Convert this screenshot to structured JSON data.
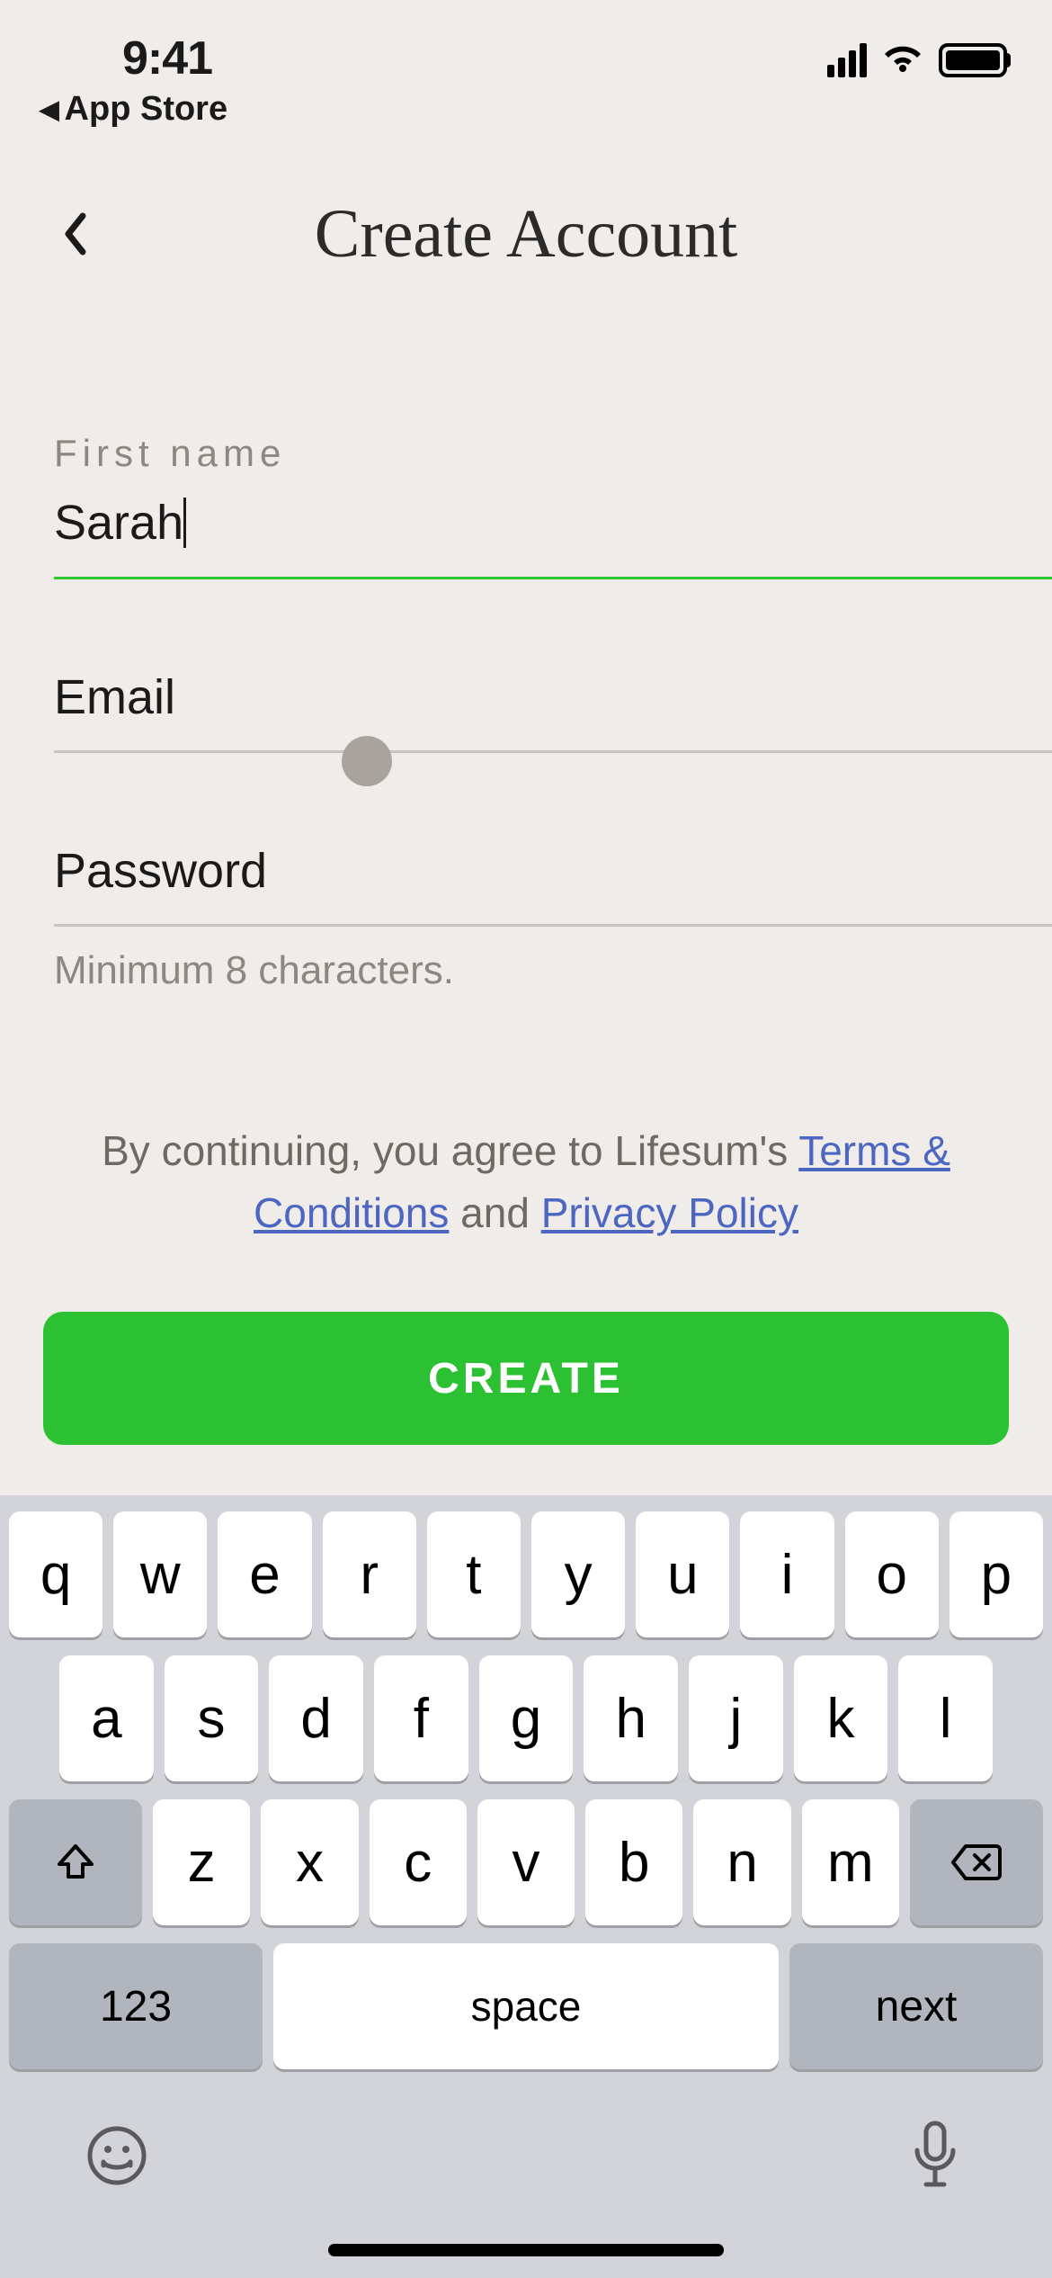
{
  "status": {
    "time": "9:41",
    "back_to_app": "App Store"
  },
  "header": {
    "title": "Create Account"
  },
  "form": {
    "first_name": {
      "label": "First name",
      "value": "Sarah"
    },
    "email": {
      "label": "Email",
      "value": ""
    },
    "password": {
      "label": "Password",
      "value": "",
      "helper": "Minimum 8 characters."
    }
  },
  "legal": {
    "prefix": "By continuing, you agree to Lifesum's ",
    "terms": "Terms & Conditions",
    "middle": " and ",
    "privacy": "Privacy Policy"
  },
  "cta": {
    "label": "CREATE"
  },
  "keyboard": {
    "row1": [
      "q",
      "w",
      "e",
      "r",
      "t",
      "y",
      "u",
      "i",
      "o",
      "p"
    ],
    "row2": [
      "a",
      "s",
      "d",
      "f",
      "g",
      "h",
      "j",
      "k",
      "l"
    ],
    "row3": [
      "z",
      "x",
      "c",
      "v",
      "b",
      "n",
      "m"
    ],
    "num": "123",
    "space": "space",
    "next": "next"
  },
  "colors": {
    "accent_green": "#2cc133",
    "focus_green": "#34c635",
    "link_blue": "#4d66c1",
    "bg": "#f0ece9"
  }
}
